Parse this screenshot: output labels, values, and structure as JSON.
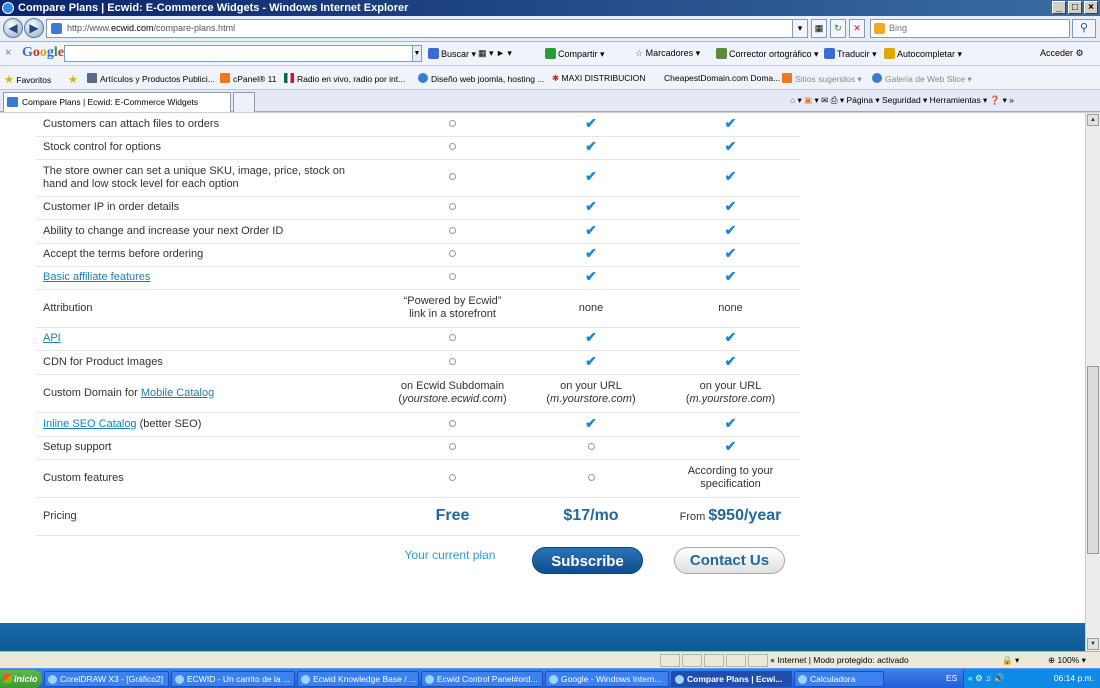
{
  "window": {
    "title": "Compare Plans | Ecwid: E-Commerce Widgets - Windows Internet Explorer",
    "buttons": [
      "_",
      "□",
      "×"
    ]
  },
  "addressbar": {
    "url_prefix": "http://www.",
    "url_domain": "ecwid.com",
    "url_path": "/compare-plans.html",
    "search_placeholder": "Bing"
  },
  "google_toolbar": {
    "logo": "Google",
    "items": [
      "Buscar ▾",
      "Compartir ▾",
      "Marcadores ▾",
      "Corrector ortográfico ▾",
      "Traducir ▾",
      "Autocompletar ▾",
      "Acceder"
    ]
  },
  "favorites": {
    "label": "Favoritos",
    "items": [
      "Artículos y Productos Publici...",
      "cPanel® 11",
      "Radio en vivo, radio por int...",
      "Diseño web joomla, hosting ...",
      "MAXI DISTRIBUCION",
      "CheapestDomain.com Doma...",
      "Sitios sugeridos ▾",
      "Galería de Web Slice ▾"
    ]
  },
  "tabs": {
    "active": "Compare Plans | Ecwid: E-Commerce Widgets",
    "command_bar": "Página ▾   Seguridad ▾   Herramientas ▾"
  },
  "table": {
    "rows": [
      {
        "feature": "Customers can attach files to orders",
        "link": false,
        "c1": {
          "type": "circle"
        },
        "c2": {
          "type": "check"
        },
        "c3": {
          "type": "check"
        }
      },
      {
        "feature": "Stock control for options",
        "link": false,
        "c1": {
          "type": "circle"
        },
        "c2": {
          "type": "check"
        },
        "c3": {
          "type": "check"
        }
      },
      {
        "feature": "The store owner can set a unique SKU, image, price, stock on hand and low stock level for each option",
        "link": false,
        "c1": {
          "type": "circle"
        },
        "c2": {
          "type": "check"
        },
        "c3": {
          "type": "check"
        }
      },
      {
        "feature": "Customer IP in order details",
        "link": false,
        "c1": {
          "type": "circle"
        },
        "c2": {
          "type": "check"
        },
        "c3": {
          "type": "check"
        }
      },
      {
        "feature": "Ability to change and increase your next Order ID",
        "link": false,
        "c1": {
          "type": "circle"
        },
        "c2": {
          "type": "check"
        },
        "c3": {
          "type": "check"
        }
      },
      {
        "feature": "Accept the terms before ordering",
        "link": false,
        "c1": {
          "type": "circle"
        },
        "c2": {
          "type": "check"
        },
        "c3": {
          "type": "check"
        }
      },
      {
        "feature": "Basic affiliate features",
        "link": true,
        "c1": {
          "type": "circle"
        },
        "c2": {
          "type": "check"
        },
        "c3": {
          "type": "check"
        }
      },
      {
        "feature": "Attribution",
        "link": false,
        "c1": {
          "type": "text",
          "text": "“Powered by Ecwid” link in a storefront"
        },
        "c2": {
          "type": "text",
          "text": "none"
        },
        "c3": {
          "type": "text",
          "text": "none"
        }
      },
      {
        "feature": "API",
        "link": true,
        "c1": {
          "type": "circle"
        },
        "c2": {
          "type": "check"
        },
        "c3": {
          "type": "check"
        }
      },
      {
        "feature": "CDN for Product Images",
        "link": false,
        "c1": {
          "type": "circle"
        },
        "c2": {
          "type": "check"
        },
        "c3": {
          "type": "check"
        }
      },
      {
        "feature": "Custom Domain for ",
        "feature_link": "Mobile Catalog",
        "link": false,
        "c1": {
          "type": "domain",
          "text": "on Ecwid Subdomain",
          "italic": "yourstore.ecwid.com"
        },
        "c2": {
          "type": "domain",
          "text": "on your URL",
          "italic": "m.yourstore.com"
        },
        "c3": {
          "type": "domain",
          "text": "on your URL",
          "italic": "m.yourstore.com"
        }
      },
      {
        "feature": "Inline SEO Catalog",
        "feature_suffix": " (better SEO)",
        "link": true,
        "c1": {
          "type": "circle"
        },
        "c2": {
          "type": "check"
        },
        "c3": {
          "type": "check"
        }
      },
      {
        "feature": "Setup support",
        "link": false,
        "c1": {
          "type": "circle"
        },
        "c2": {
          "type": "circle"
        },
        "c3": {
          "type": "check"
        }
      },
      {
        "feature": "Custom features",
        "link": false,
        "c1": {
          "type": "circle"
        },
        "c2": {
          "type": "circle"
        },
        "c3": {
          "type": "text",
          "text": "According to your specification"
        }
      },
      {
        "feature": "Pricing",
        "link": false,
        "c1": {
          "type": "price",
          "text": "Free"
        },
        "c2": {
          "type": "price",
          "text": "$17/mo"
        },
        "c3": {
          "type": "price",
          "prefix": "From ",
          "text": "$950/year"
        }
      }
    ]
  },
  "actions": {
    "current_plan": "Your current plan",
    "subscribe": "Subscribe",
    "contact": "Contact Us"
  },
  "statusbar": {
    "zone": "Internet | Modo protegido: activado",
    "zoom": "100%"
  },
  "taskbar": {
    "start": "Inicio",
    "tasks": [
      {
        "label": "CorelDRAW X3 - [Gráfico2]",
        "active": false
      },
      {
        "label": "ECWID - Un carrito de la ...",
        "active": false
      },
      {
        "label": "Ecwid Knowledge Base / ...",
        "active": false
      },
      {
        "label": "Ecwid Control Panel#ord...",
        "active": false
      },
      {
        "label": "Google - Windows Intern...",
        "active": false
      },
      {
        "label": "Compare Plans | Ecwi...",
        "active": true
      },
      {
        "label": "Calculadora",
        "active": false
      }
    ],
    "lang": "ES",
    "time": "06:14 p.m."
  },
  "colors": {
    "check": "#1e88d6",
    "link": "#1a7fb8",
    "price": "#1f6a9a",
    "subscribe_bg": "#1a5fa0",
    "footer_band": "#1868a8"
  }
}
